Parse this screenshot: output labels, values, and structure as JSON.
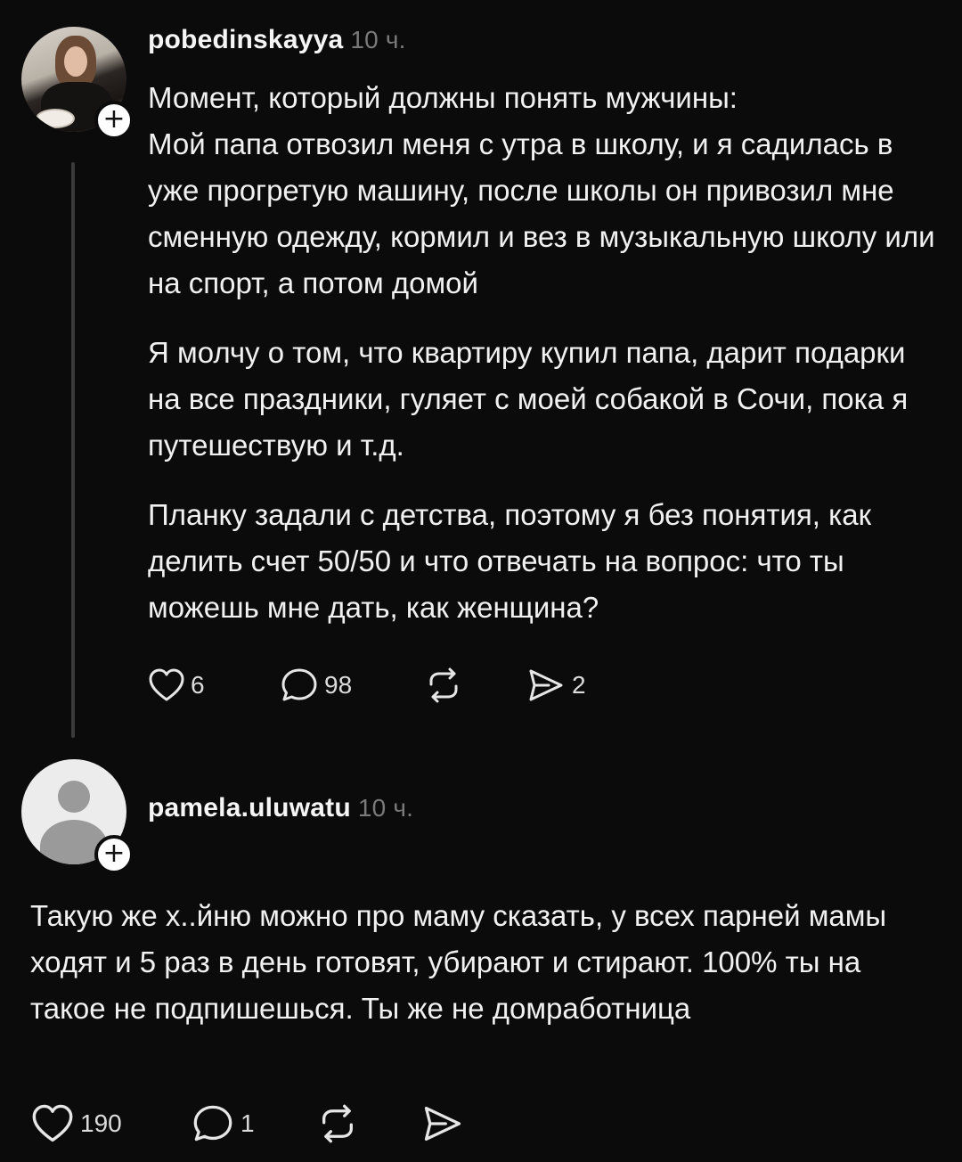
{
  "posts": [
    {
      "username": "pobedinskayya",
      "time": "10 ч.",
      "paragraphs": [
        "Момент, который должны понять мужчины:",
        "Мой папа отвозил меня с утра в школу, и я садилась в уже прогретую машину, после школы он привозил мне сменную одежду, кормил и вез в музыкальную школу или на спорт, а потом домой",
        "Я молчу о том, что квартиру купил папа, дарит подарки на все праздники, гуляет с моей собакой в Сочи, пока я путешествую и т.д.",
        "Планку задали с детства, поэтому я без понятия, как делить счет 50/50 и что отвечать на вопрос: что ты можешь мне дать, как женщина?"
      ],
      "likes": "6",
      "replies": "98",
      "reposts": "",
      "shares": "2"
    },
    {
      "username": "pamela.uluwatu",
      "time": "10 ч.",
      "text": "Такую же х..йню можно про маму сказать, у всех парней мамы ходят и 5 раз в день готовят, убирают и стирают. 100% ты на такое не подпишешься. Ты же не домработница",
      "likes": "190",
      "replies": "1",
      "reposts": "",
      "shares": ""
    }
  ],
  "icons": {
    "like": "heart-icon",
    "reply": "comment-icon",
    "repost": "repost-icon",
    "share": "share-icon",
    "follow": "plus-icon"
  },
  "colors": {
    "background": "#0b0b0b",
    "text": "#f1f1f1",
    "muted": "#7a7a7a",
    "thread_line": "#3a3a3a"
  }
}
